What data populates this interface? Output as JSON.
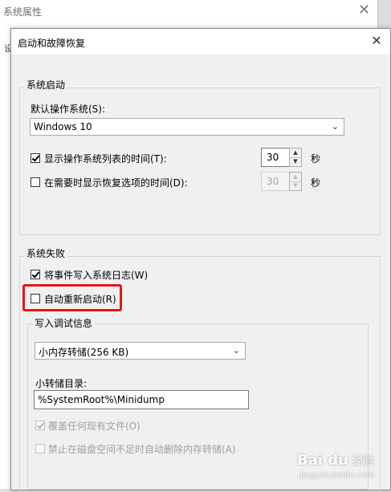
{
  "background_window": {
    "title": "系统属性",
    "tab_stub": "设"
  },
  "dialog": {
    "title": "启动和故障恢复",
    "startup": {
      "legend": "系统启动",
      "default_os_label": "默认操作系统(S):",
      "default_os_value": "Windows 10",
      "show_list": {
        "label": "显示操作系统列表的时间(T):",
        "checked": true,
        "value": "30",
        "unit": "秒"
      },
      "show_recovery": {
        "label": "在需要时显示恢复选项的时间(D):",
        "checked": false,
        "value": "30",
        "unit": "秒"
      }
    },
    "failure": {
      "legend": "系统失败",
      "write_event": {
        "label": "将事件写入系统日志(W)",
        "checked": true
      },
      "auto_restart": {
        "label": "自动重新启动(R)",
        "checked": false
      },
      "debug": {
        "legend": "写入调试信息",
        "dump_type": "小内存转储(256 KB)",
        "dir_label": "小转储目录:",
        "dir_value": "%SystemRoot%\\Minidump",
        "overwrite": {
          "label": "覆盖任何现有文件(O)",
          "checked": true
        },
        "disable_auto_delete": {
          "label": "禁止在磁盘空间不足时自动删除内存转储(A)",
          "checked": false
        }
      }
    }
  },
  "watermark": {
    "brand": "Bai du",
    "cn": "经验",
    "url": "jingyan.baidu.com"
  },
  "colors": {
    "highlight_border": "#e4161b",
    "dialog_bg": "#f0f0f0"
  }
}
